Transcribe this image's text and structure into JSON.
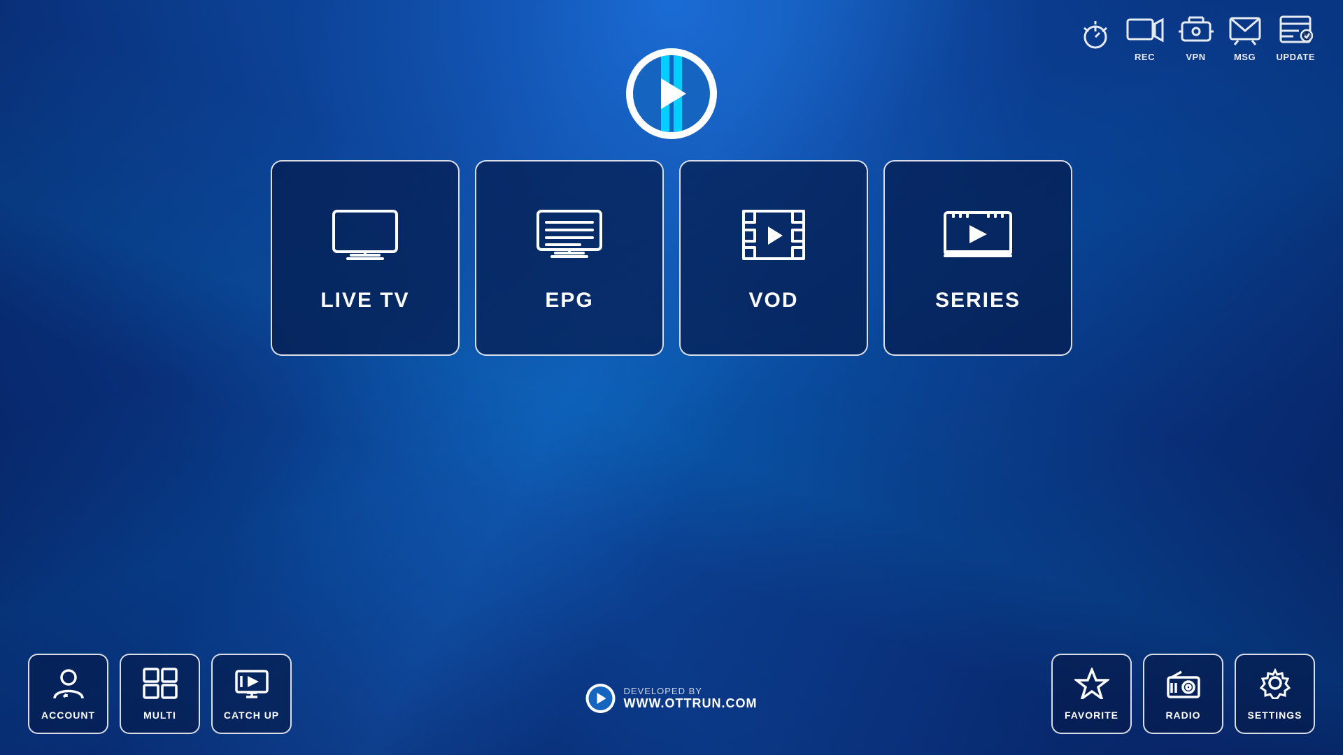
{
  "logo": {
    "alt": "OTTRun Logo"
  },
  "top_icons": [
    {
      "id": "alarm",
      "label": "",
      "icon": "alarm"
    },
    {
      "id": "rec",
      "label": "REC",
      "icon": "rec"
    },
    {
      "id": "vpn",
      "label": "VPN",
      "icon": "vpn"
    },
    {
      "id": "msg",
      "label": "MSG",
      "icon": "msg"
    },
    {
      "id": "update",
      "label": "UPDATE",
      "icon": "update"
    }
  ],
  "main_cards": [
    {
      "id": "live-tv",
      "label": "LIVE TV",
      "icon": "tv"
    },
    {
      "id": "epg",
      "label": "EPG",
      "icon": "epg"
    },
    {
      "id": "vod",
      "label": "VOD",
      "icon": "vod"
    },
    {
      "id": "series",
      "label": "SERIES",
      "icon": "series"
    }
  ],
  "bottom_left": [
    {
      "id": "account",
      "label": "ACCOUNT",
      "icon": "account"
    },
    {
      "id": "multi",
      "label": "MULTI",
      "icon": "multi"
    },
    {
      "id": "catchup",
      "label": "CATCH UP",
      "icon": "catchup"
    }
  ],
  "bottom_right": [
    {
      "id": "favorite",
      "label": "FAVORITE",
      "icon": "favorite"
    },
    {
      "id": "radio",
      "label": "RADIO",
      "icon": "radio"
    },
    {
      "id": "settings",
      "label": "SETTINGS",
      "icon": "settings"
    }
  ],
  "developer": {
    "prefix": "DEVELOPED BY",
    "url": "WWW.OTTRUN.COM"
  }
}
